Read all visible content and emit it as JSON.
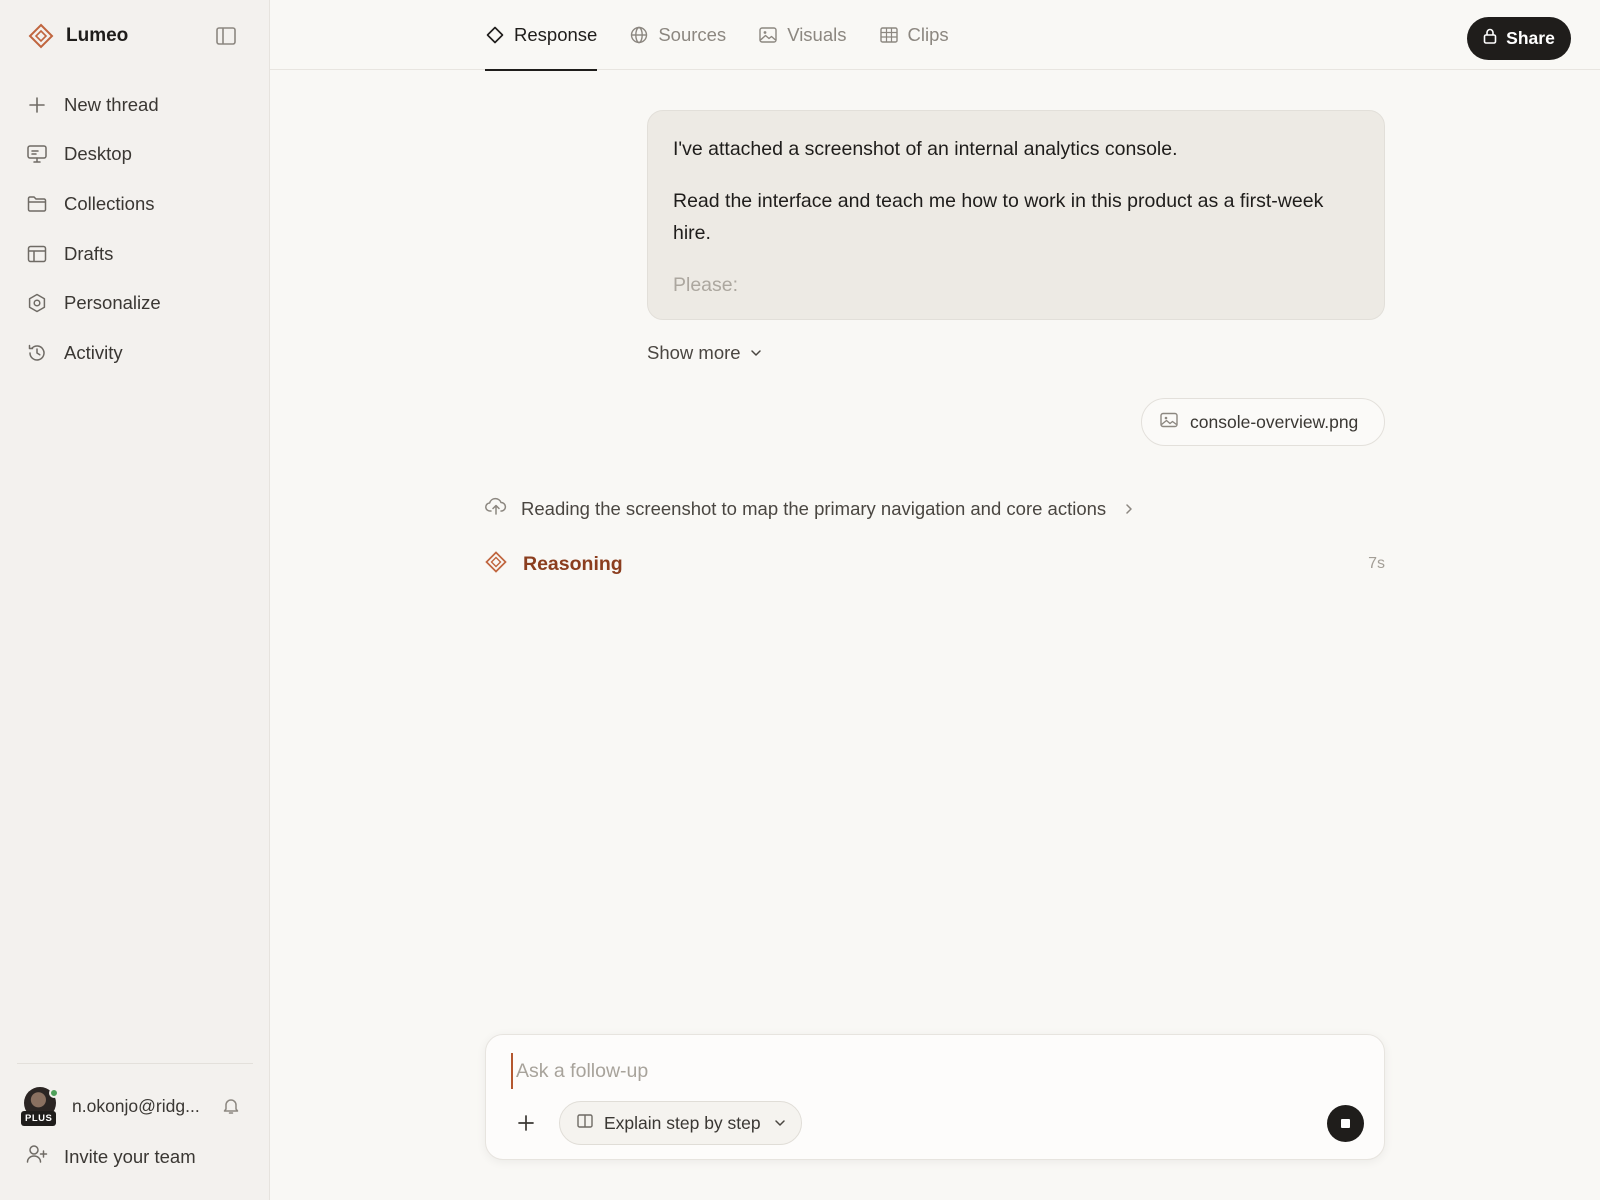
{
  "brand": {
    "name": "Lumeo",
    "accent": "#c0653e"
  },
  "sidebar": {
    "items": [
      {
        "label": "New thread",
        "icon": "plus-icon"
      },
      {
        "label": "Desktop",
        "icon": "monitor-icon"
      },
      {
        "label": "Collections",
        "icon": "folder-icon"
      },
      {
        "label": "Drafts",
        "icon": "layout-icon"
      },
      {
        "label": "Personalize",
        "icon": "hexagon-settings-icon"
      },
      {
        "label": "Activity",
        "icon": "history-icon"
      }
    ],
    "user": {
      "email": "n.okonjo@ridg...",
      "plan_badge": "PLUS",
      "status_color": "#4fa15b"
    },
    "invite_label": "Invite your team"
  },
  "header": {
    "tabs": [
      {
        "label": "Response",
        "icon": "diamond-icon",
        "active": true
      },
      {
        "label": "Sources",
        "icon": "globe-icon",
        "active": false
      },
      {
        "label": "Visuals",
        "icon": "image-icon",
        "active": false
      },
      {
        "label": "Clips",
        "icon": "table-icon",
        "active": false
      }
    ],
    "share_label": "Share"
  },
  "message": {
    "paragraphs": [
      "I've attached a screenshot of an internal analytics console.",
      "Read the interface and teach me how to work in this product as a first-week hire.",
      "Please:"
    ],
    "show_more_label": "Show more",
    "attachment_name": "console-overview.png"
  },
  "response": {
    "step_text": "Reading the screenshot to map the primary navigation and core actions",
    "reasoning_label": "Reasoning",
    "reasoning_time": "7s",
    "reasoning_color": "#8b3e1f"
  },
  "composer": {
    "placeholder": "Ask a follow-up",
    "mode_label": "Explain step by step"
  }
}
